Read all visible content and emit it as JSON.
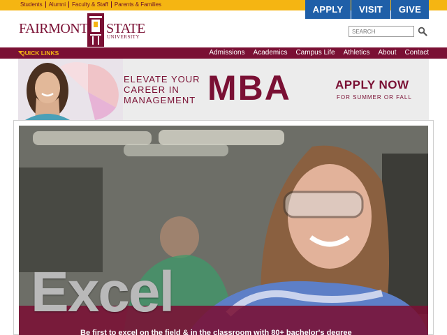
{
  "utility_links": [
    "Students",
    "Alumni",
    "Faculty & Staff",
    "Parents & Families"
  ],
  "cta": {
    "apply": "APPLY",
    "visit": "VISIT",
    "give": "GIVE"
  },
  "logo": {
    "word1": "FAIRMONT",
    "word2": "STATE",
    "word3": "UNIVERSITY"
  },
  "search": {
    "placeholder": "SEARCH"
  },
  "nav": {
    "quick_links": "QUICK LINKS",
    "items": [
      "Admissions",
      "Academics",
      "Campus Life",
      "Athletics",
      "About",
      "Contact"
    ]
  },
  "banner": {
    "line1": "ELEVATE YOUR",
    "line2": "CAREER IN",
    "line3": "MANAGEMENT",
    "mba": "MBA",
    "apply": "APPLY NOW",
    "sub": "FOR SUMMER OR FALL"
  },
  "hero": {
    "headline": "Excel",
    "caption": "Be first to excel on the field & in the classroom with 80+ bachelor's degree"
  },
  "colors": {
    "maroon": "#7a1034",
    "gold": "#f5b512",
    "blue": "#1f5fa8"
  }
}
